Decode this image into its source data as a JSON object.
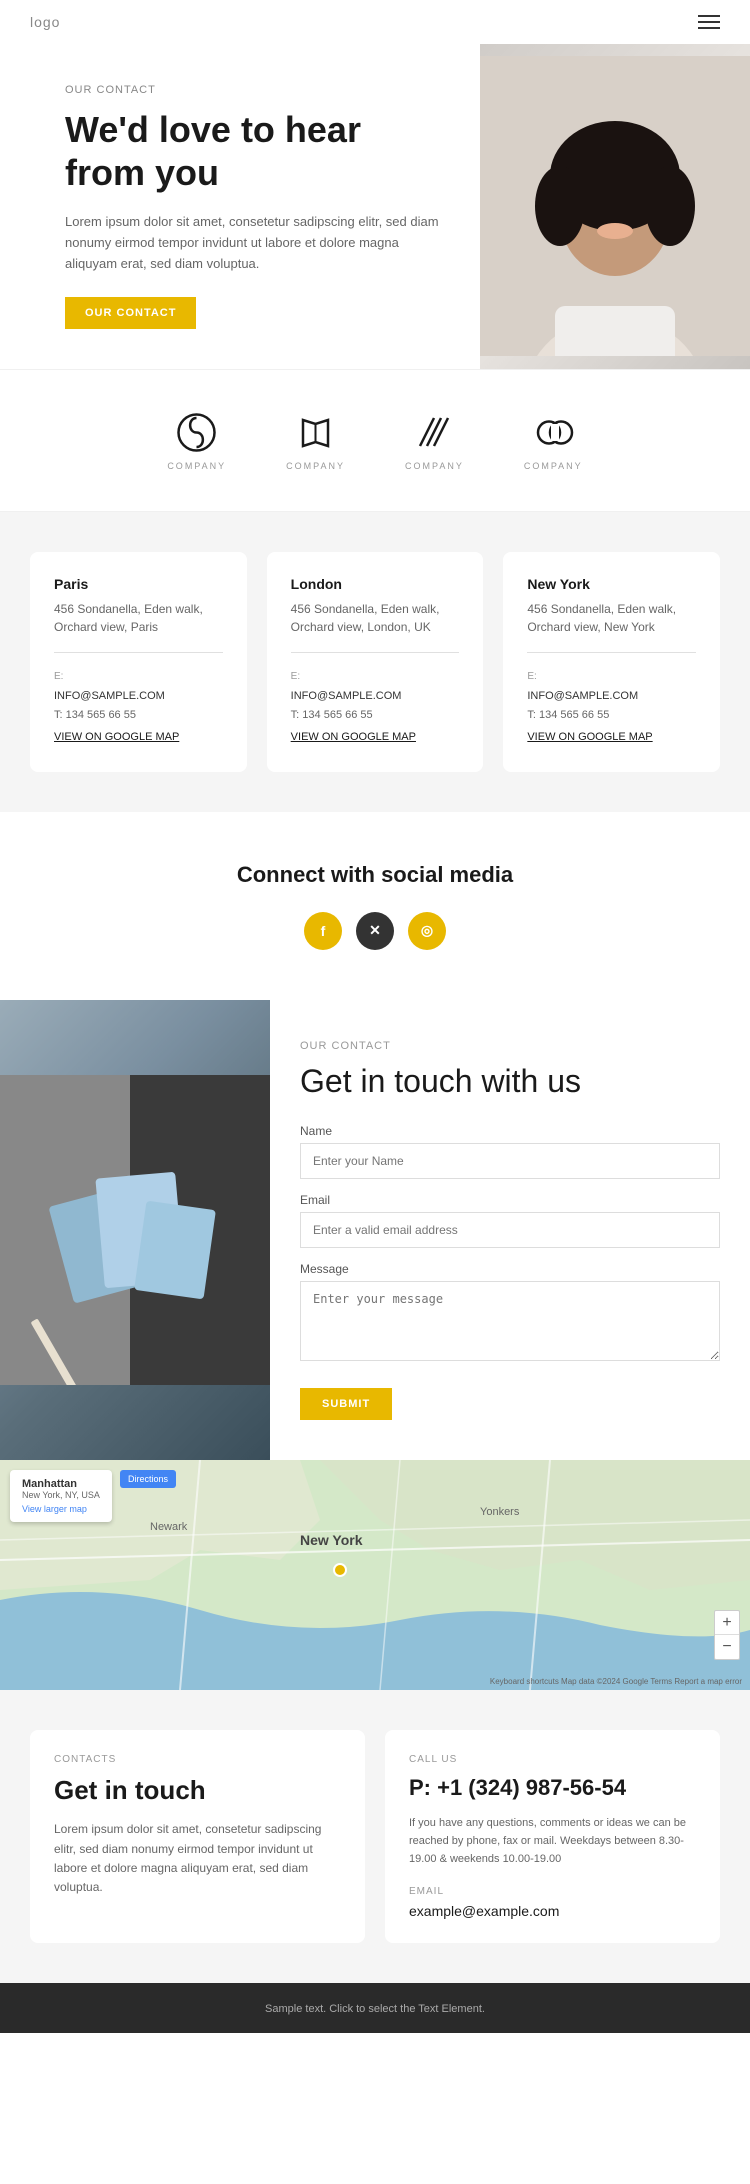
{
  "header": {
    "logo": "logo",
    "menu_icon": "≡"
  },
  "hero": {
    "our_contact_label": "OUR CONTACT",
    "title": "We'd love to hear from you",
    "description": "Lorem ipsum dolor sit amet, consetetur sadipscing elitr, sed diam nonumy eirmod tempor invidunt ut labore et dolore magna aliquyam erat, sed diam voluptua.",
    "cta_button": "OUR CONTACT"
  },
  "logos": {
    "items": [
      {
        "name": "COMPANY",
        "shape": "circle-o"
      },
      {
        "name": "COMPANY",
        "shape": "book"
      },
      {
        "name": "COMPANY",
        "shape": "lines"
      },
      {
        "name": "COMPANY",
        "shape": "ring"
      }
    ]
  },
  "offices": {
    "items": [
      {
        "city": "Paris",
        "address": "456 Sondanella, Eden walk, Orchard view, Paris",
        "email_label": "E:",
        "email": "INFO@SAMPLE.COM",
        "phone_label": "T:",
        "phone": "134 565 66 55",
        "map_link": "VIEW ON GOOGLE MAP"
      },
      {
        "city": "London",
        "address": "456 Sondanella, Eden walk, Orchard view, London, UK",
        "email_label": "E:",
        "email": "INFO@SAMPLE.COM",
        "phone_label": "T:",
        "phone": "134 565 66 55",
        "map_link": "VIEW ON GOOGLE MAP"
      },
      {
        "city": "New York",
        "address": "456 Sondanella, Eden walk, Orchard view, New York",
        "email_label": "E:",
        "email": "INFO@SAMPLE.COM",
        "phone_label": "T:",
        "phone": "134 565 66 55",
        "map_link": "VIEW ON GOOGLE MAP"
      }
    ]
  },
  "social": {
    "title": "Connect with social media",
    "icons": [
      {
        "name": "Facebook",
        "symbol": "f",
        "type": "facebook"
      },
      {
        "name": "X (Twitter)",
        "symbol": "✕",
        "type": "x"
      },
      {
        "name": "Instagram",
        "symbol": "◎",
        "type": "instagram"
      }
    ]
  },
  "contact_form": {
    "our_contact_label": "OUR CONTACT",
    "title": "Get in touch with us",
    "name_label": "Name",
    "name_placeholder": "Enter your Name",
    "email_label": "Email",
    "email_placeholder": "Enter a valid email address",
    "message_label": "Message",
    "message_placeholder": "Enter your message",
    "submit_button": "SUBMIT"
  },
  "map": {
    "location_name": "Manhattan",
    "location_sub": "New York, NY, USA",
    "view_larger": "View larger map",
    "directions": "Directions",
    "zoom_in": "+",
    "zoom_out": "−",
    "copyright": "Keyboard shortcuts  Map data ©2024 Google  Terms  Report a map error"
  },
  "bottom_contact": {
    "left": {
      "label": "CONTACTS",
      "title": "Get in touch",
      "description": "Lorem ipsum dolor sit amet, consetetur sadipscing elitr, sed diam nonumy eirmod tempor invidunt ut labore et dolore magna aliquyam erat, sed diam voluptua."
    },
    "right": {
      "label": "CALL US",
      "phone": "P: +1 (324) 987-56-54",
      "call_desc": "If you have any questions, comments or ideas we can be reached by phone, fax or mail. Weekdays between 8.30-19.00 & weekends 10.00-19.00",
      "email_label": "EMAIL",
      "email": "example@example.com"
    }
  },
  "footer": {
    "text": "Sample text. Click to select the Text Element."
  }
}
